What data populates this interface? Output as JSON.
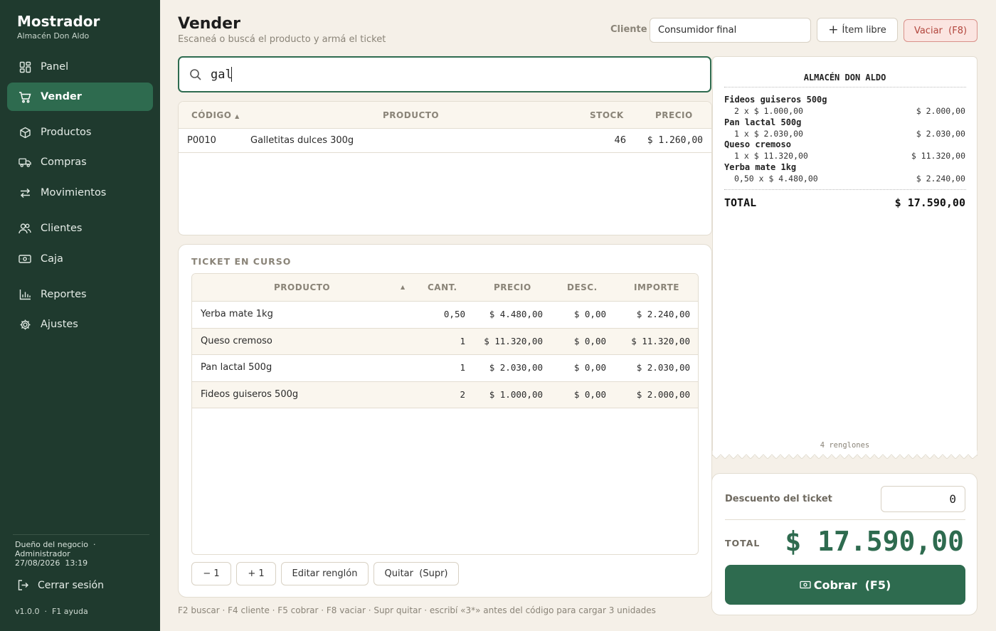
{
  "brand": {
    "title": "Mostrador",
    "subtitle": "Almacén Don Aldo"
  },
  "nav": [
    {
      "label": "Panel",
      "icon": "dashboard-icon"
    },
    {
      "label": "Vender",
      "icon": "cart-icon",
      "active": true
    },
    {
      "label": "Productos",
      "icon": "box-icon"
    },
    {
      "label": "Compras",
      "icon": "truck-icon"
    },
    {
      "label": "Movimientos",
      "icon": "arrows-icon"
    },
    {
      "label": "Clientes",
      "icon": "users-icon"
    },
    {
      "label": "Caja",
      "icon": "cash-icon"
    },
    {
      "label": "Reportes",
      "icon": "chart-icon"
    },
    {
      "label": "Ajustes",
      "icon": "gear-icon"
    }
  ],
  "user": {
    "role": "Dueño del negocio",
    "separator": "·",
    "name": "Administrador",
    "datetime": "27/08/2026  13:19"
  },
  "logout_label": "Cerrar sesión",
  "version": "v1.0.0  ·  F1 ayuda",
  "header": {
    "title": "Vender",
    "subtitle": "Escaneá o buscá el producto y armá el ticket",
    "client_label": "Cliente",
    "client_value": "Consumidor final",
    "free_item_label": "Ítem libre",
    "clear_label": "Vaciar  (F8)"
  },
  "search": {
    "value": "gal"
  },
  "results": {
    "columns": {
      "code": "CÓDIGO",
      "product": "PRODUCTO",
      "stock": "STOCK",
      "price": "PRECIO"
    },
    "rows": [
      {
        "code": "P0010",
        "product": "Galletitas dulces 300g",
        "stock": "46",
        "price": "$ 1.260,00"
      }
    ]
  },
  "ticket": {
    "title": "TICKET EN CURSO",
    "columns": {
      "product": "PRODUCTO",
      "qty": "CANT.",
      "price": "PRECIO",
      "disc": "DESC.",
      "amount": "IMPORTE"
    },
    "rows": [
      {
        "product": "Yerba mate 1kg",
        "qty": "0,50",
        "price": "$ 4.480,00",
        "disc": "$ 0,00",
        "amount": "$ 2.240,00"
      },
      {
        "product": "Queso cremoso",
        "qty": "1",
        "price": "$ 11.320,00",
        "disc": "$ 0,00",
        "amount": "$ 11.320,00"
      },
      {
        "product": "Pan lactal 500g",
        "qty": "1",
        "price": "$ 2.030,00",
        "disc": "$ 0,00",
        "amount": "$ 2.030,00"
      },
      {
        "product": "Fideos guiseros 500g",
        "qty": "2",
        "price": "$ 1.000,00",
        "disc": "$ 0,00",
        "amount": "$ 2.000,00"
      }
    ],
    "actions": {
      "minus": "− 1",
      "plus": "+ 1",
      "edit": "Editar renglón",
      "remove": "Quitar  (Supr)"
    }
  },
  "receipt": {
    "store": "ALMACÉN DON ALDO",
    "items": [
      {
        "name": "Fideos guiseros 500g",
        "detail": "2 x $ 1.000,00",
        "amount": "$ 2.000,00"
      },
      {
        "name": "Pan lactal 500g",
        "detail": "1 x $ 2.030,00",
        "amount": "$ 2.030,00"
      },
      {
        "name": "Queso cremoso",
        "detail": "1 x $ 11.320,00",
        "amount": "$ 11.320,00"
      },
      {
        "name": "Yerba mate 1kg",
        "detail": "0,50 x $ 4.480,00",
        "amount": "$ 2.240,00"
      }
    ],
    "total_label": "TOTAL",
    "total_value": "$ 17.590,00",
    "lines_count": "4 renglones"
  },
  "payment": {
    "discount_label": "Descuento del ticket",
    "discount_value": "0",
    "total_label": "TOTAL",
    "total_value": "$ 17.590,00",
    "pay_label": "Cobrar  (F5)"
  },
  "footer_hint": "F2 buscar · F4 cliente · F5 cobrar · F8 vaciar · Supr quitar · escribí «3*» antes del código para cargar 3 unidades",
  "colors": {
    "sidebar": "#1f3a2e",
    "accent": "#2e6b4f",
    "background": "#f5f0e8",
    "danger": "#b2463d"
  }
}
